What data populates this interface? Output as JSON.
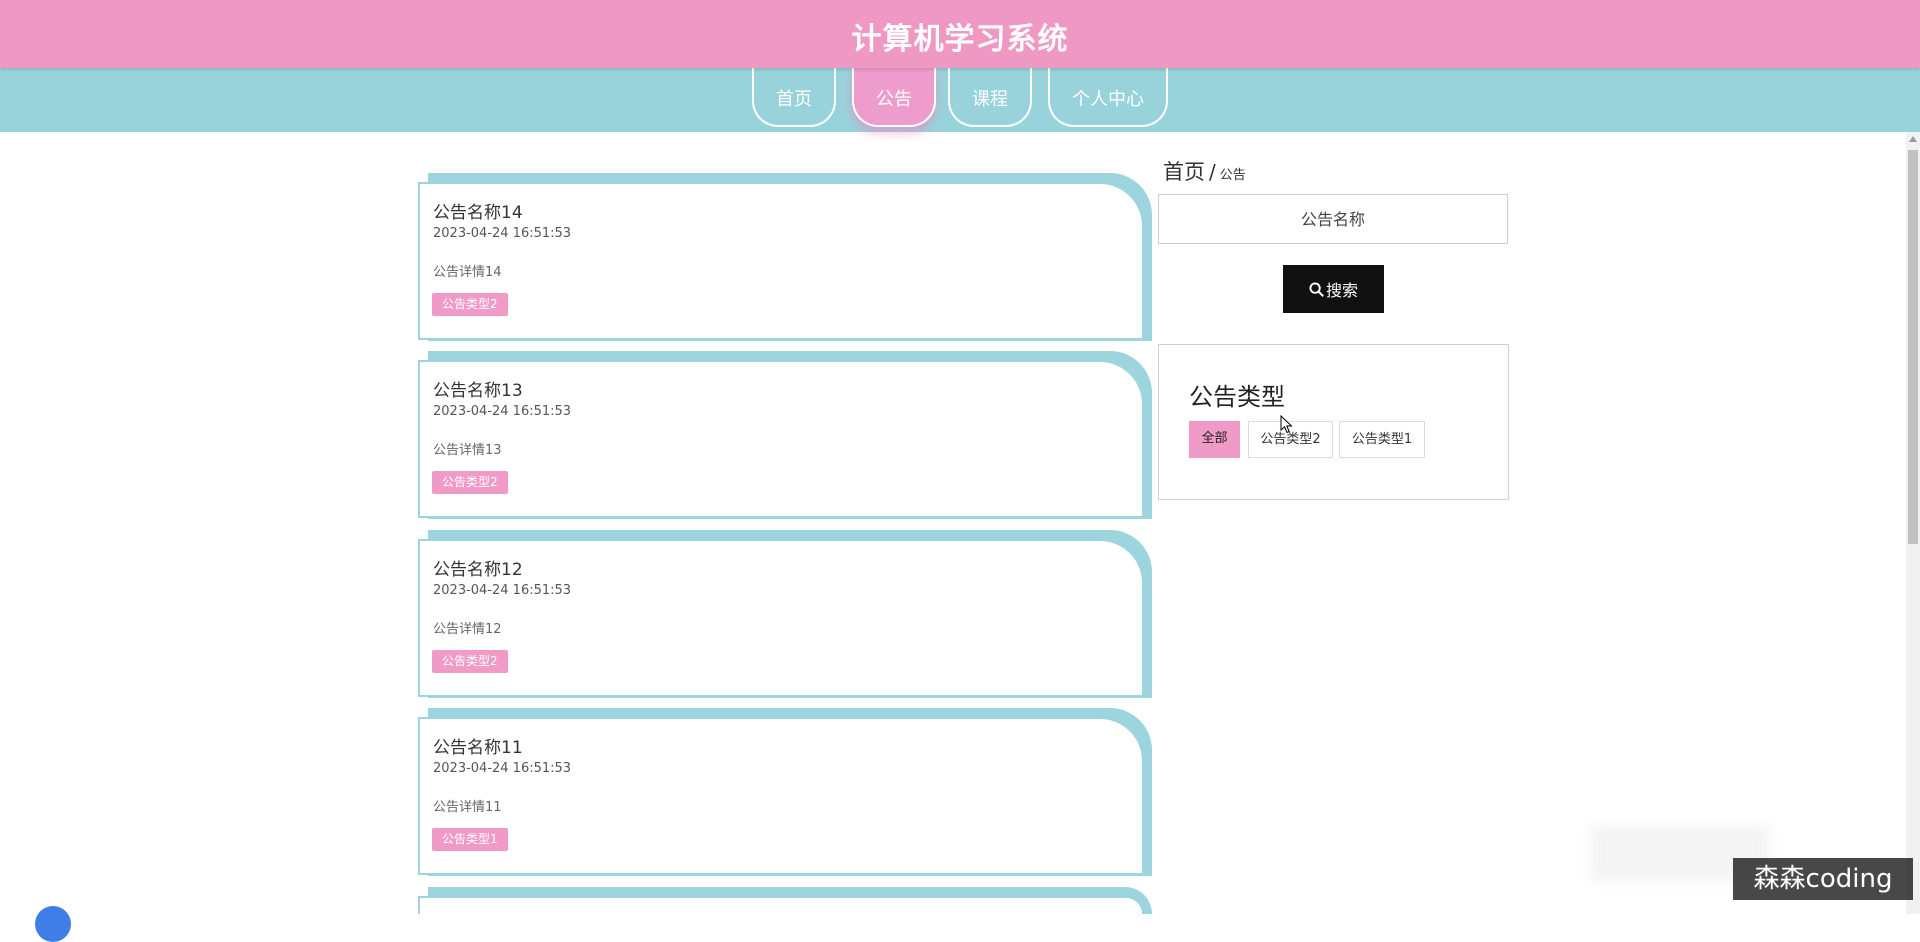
{
  "header": {
    "title": "计算机学习系统"
  },
  "nav": {
    "items": [
      {
        "label": "首页"
      },
      {
        "label": "公告"
      },
      {
        "label": "课程"
      },
      {
        "label": "个人中心"
      }
    ]
  },
  "notices": [
    {
      "title": "公告名称14",
      "time": "2023-04-24 16:51:53",
      "detail": "公告详情14",
      "tag": "公告类型2"
    },
    {
      "title": "公告名称13",
      "time": "2023-04-24 16:51:53",
      "detail": "公告详情13",
      "tag": "公告类型2"
    },
    {
      "title": "公告名称12",
      "time": "2023-04-24 16:51:53",
      "detail": "公告详情12",
      "tag": "公告类型2"
    },
    {
      "title": "公告名称11",
      "time": "2023-04-24 16:51:53",
      "detail": "公告详情11",
      "tag": "公告类型1"
    }
  ],
  "breadcrumb": {
    "home": "首页",
    "separator": "/",
    "current": "公告"
  },
  "search": {
    "placeholder": "公告名称",
    "button_label": "搜索"
  },
  "type_filter": {
    "title": "公告类型",
    "options": [
      {
        "label": "全部"
      },
      {
        "label": "公告类型2"
      },
      {
        "label": "公告类型1"
      }
    ]
  },
  "watermark": "森森coding",
  "colors": {
    "header_pink": "#f098c4",
    "nav_teal": "#98d3dc",
    "tag_pink": "#f09ac8",
    "button_black": "#111111"
  }
}
